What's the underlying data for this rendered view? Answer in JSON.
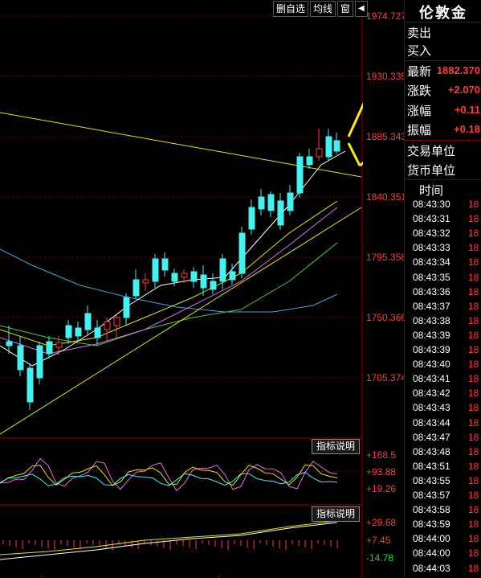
{
  "toolbar": {
    "delete_watchlist": "删自选",
    "ma_lines": "均线",
    "window": "窗",
    "arrow": "◀▶"
  },
  "price_axis": [
    "1974.727",
    "1930.335",
    "1885.343",
    "1840.351",
    "1795.358",
    "1750.366",
    "1705.374"
  ],
  "indicator1": {
    "button": "指标说明",
    "ticks": [
      "+168.5",
      "+93.88",
      "+19.26"
    ]
  },
  "indicator2": {
    "button": "指标说明",
    "ticks": [
      "+29.68",
      "+7.45",
      "-14.78"
    ]
  },
  "sidebar": {
    "title": "伦敦金",
    "sell": "卖出",
    "buy": "买入",
    "latest_label": "最新",
    "latest_value": "1882.370",
    "change_label": "涨跌",
    "change_value": "+2.070",
    "change_pct_label": "涨幅",
    "change_pct_value": "+0.11",
    "amplitude_label": "振幅",
    "amplitude_value": "+0.18",
    "trade_unit": "交易单位",
    "currency_unit": "货币单位",
    "time_header": "时间",
    "ticks": [
      {
        "time": "08:43:30",
        "price": "18"
      },
      {
        "time": "08:43:31",
        "price": "18"
      },
      {
        "time": "08:43:32",
        "price": "18"
      },
      {
        "time": "08:43:33",
        "price": "18"
      },
      {
        "time": "08:43:34",
        "price": "18"
      },
      {
        "time": "08:43:35",
        "price": "18"
      },
      {
        "time": "08:43:36",
        "price": "18"
      },
      {
        "time": "08:43:37",
        "price": "18"
      },
      {
        "time": "08:43:38",
        "price": "18"
      },
      {
        "time": "08:43:39",
        "price": "18"
      },
      {
        "time": "08:43:39",
        "price": "18"
      },
      {
        "time": "08:43:40",
        "price": "18"
      },
      {
        "time": "08:43:41",
        "price": "18"
      },
      {
        "time": "08:43:42",
        "price": "18"
      },
      {
        "time": "08:43:43",
        "price": "18"
      },
      {
        "time": "08:43:44",
        "price": "18"
      },
      {
        "time": "08:43:47",
        "price": "18"
      },
      {
        "time": "08:43:48",
        "price": "18"
      },
      {
        "time": "08:43:51",
        "price": "18"
      },
      {
        "time": "08:43:55",
        "price": "18"
      },
      {
        "time": "08:43:57",
        "price": "18"
      },
      {
        "time": "08:43:58",
        "price": "18"
      },
      {
        "time": "08:43:59",
        "price": "18"
      },
      {
        "time": "08:44:00",
        "price": "18"
      },
      {
        "time": "08:44:00",
        "price": "18"
      },
      {
        "time": "08:44:03",
        "price": "18"
      }
    ]
  },
  "colors": {
    "up": "#ff3b3b",
    "down": "#44f0f0",
    "grid": "#7a0000",
    "annotation": "#ffee00"
  }
}
